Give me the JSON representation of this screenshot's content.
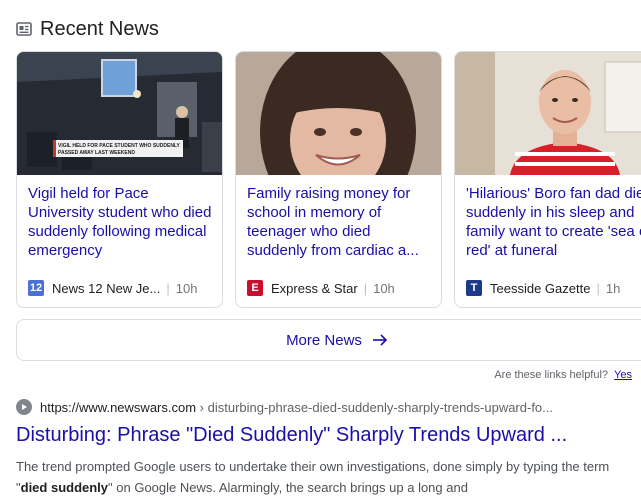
{
  "header": {
    "title": "Recent News",
    "icon": "newspaper-icon"
  },
  "cards": [
    {
      "headline": "Vigil held for Pace University student who died suddenly following medical emergency",
      "image_caption": "VIGIL HELD FOR PACE STUDENT WHO SUDDENLY PASSED AWAY LAST WEEKEND",
      "source": "News 12 New Je...",
      "time": "10h",
      "logo_text": "12",
      "logo_color": "#4a6fd6"
    },
    {
      "headline": "Family raising money for school in memory of teenager who died suddenly from cardiac a...",
      "source": "Express & Star",
      "time": "10h",
      "logo_text": "E",
      "logo_color": "#c8102e"
    },
    {
      "headline": "'Hilarious' Boro fan dad dies suddenly in his sleep and family want to create 'sea of red' at funeral",
      "source": "Teesside Gazette",
      "time": "1h",
      "logo_text": "T",
      "logo_color": "#1b3a8a"
    }
  ],
  "more_news": {
    "label": "More News",
    "icon": "arrow-right-icon"
  },
  "helpful": {
    "question": "Are these links helpful?",
    "yes": "Yes"
  },
  "result": {
    "domain": "https://www.newswars.com",
    "path": "› disturbing-phrase-died-suddenly-sharply-trends-upward-fo...",
    "title": "Disturbing: Phrase \"Died Suddenly\" Sharply Trends Upward ...",
    "snippet_1": "The trend prompted Google users to undertake their own investigations, done simply by typing the term \"",
    "snippet_bold": "died suddenly",
    "snippet_2": "\" on Google News. Alarmingly, the search brings up a long and"
  },
  "colors": {
    "link": "#1a0dab",
    "border": "#dadce0",
    "muted": "#70757a"
  }
}
